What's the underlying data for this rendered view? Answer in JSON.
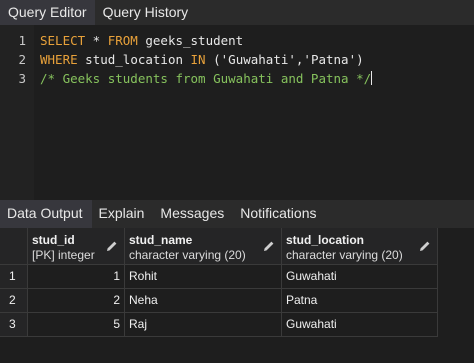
{
  "editor_tabs": [
    "Query Editor",
    "Query History"
  ],
  "code": {
    "line_numbers": [
      "1",
      "2",
      "3"
    ],
    "line1": {
      "kw1": "SELECT",
      "star": " * ",
      "kw2": "FROM",
      "table": " geeks_student"
    },
    "line2": {
      "kw1": "WHERE",
      "col": " stud_location ",
      "kw2": "IN",
      "rest": " ('Guwahati','Patna')"
    },
    "line3": {
      "comment": "/* Geeks students from Guwahati and Patna */"
    }
  },
  "output_tabs": [
    "Data Output",
    "Explain",
    "Messages",
    "Notifications"
  ],
  "grid": {
    "columns": [
      {
        "name": "stud_id",
        "type": "[PK] integer"
      },
      {
        "name": "stud_name",
        "type": "character varying (20)"
      },
      {
        "name": "stud_location",
        "type": "character varying (20)"
      }
    ],
    "rows": [
      {
        "n": "1",
        "id": "1",
        "name": "Rohit",
        "location": "Guwahati"
      },
      {
        "n": "2",
        "id": "2",
        "name": "Neha",
        "location": "Patna"
      },
      {
        "n": "3",
        "id": "5",
        "name": "Raj",
        "location": "Guwahati"
      }
    ]
  },
  "colors": {
    "keyword": "#e8a13a",
    "comment": "#86c25d",
    "background": "#1e1e1e"
  },
  "icons": {
    "column_edit": "pencil-icon"
  }
}
